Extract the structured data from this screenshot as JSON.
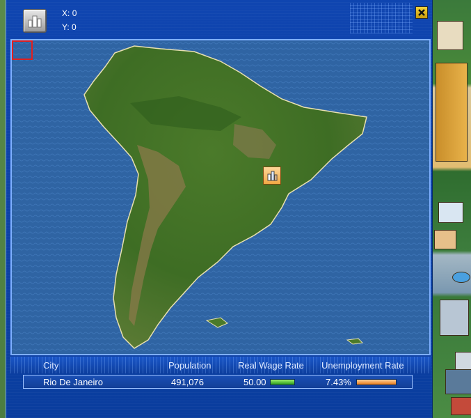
{
  "header": {
    "x_label": "X:",
    "x_value": "0",
    "y_label": "Y:",
    "y_value": "0",
    "map_icon": "city-buildings-icon",
    "close_icon": "close-icon"
  },
  "map": {
    "selected_city_marker_icon": "city-marker-icon"
  },
  "table": {
    "columns": [
      "City",
      "Population",
      "Real Wage Rate",
      "Unemployment Rate"
    ],
    "rows": [
      {
        "city": "Rio De Janeiro",
        "population": "491,076",
        "real_wage_rate": "50.00",
        "unemployment_rate": "7.43%",
        "wage_bar_fraction": 0.5,
        "unemployment_bar_fraction": 0.74
      }
    ]
  },
  "colors": {
    "window_blue": "#1346a8",
    "accent_yellow": "#f5d33a",
    "wage_bar": "#2a9a1a",
    "unemployment_bar": "#e87a18",
    "viewport_red": "#e02020"
  }
}
